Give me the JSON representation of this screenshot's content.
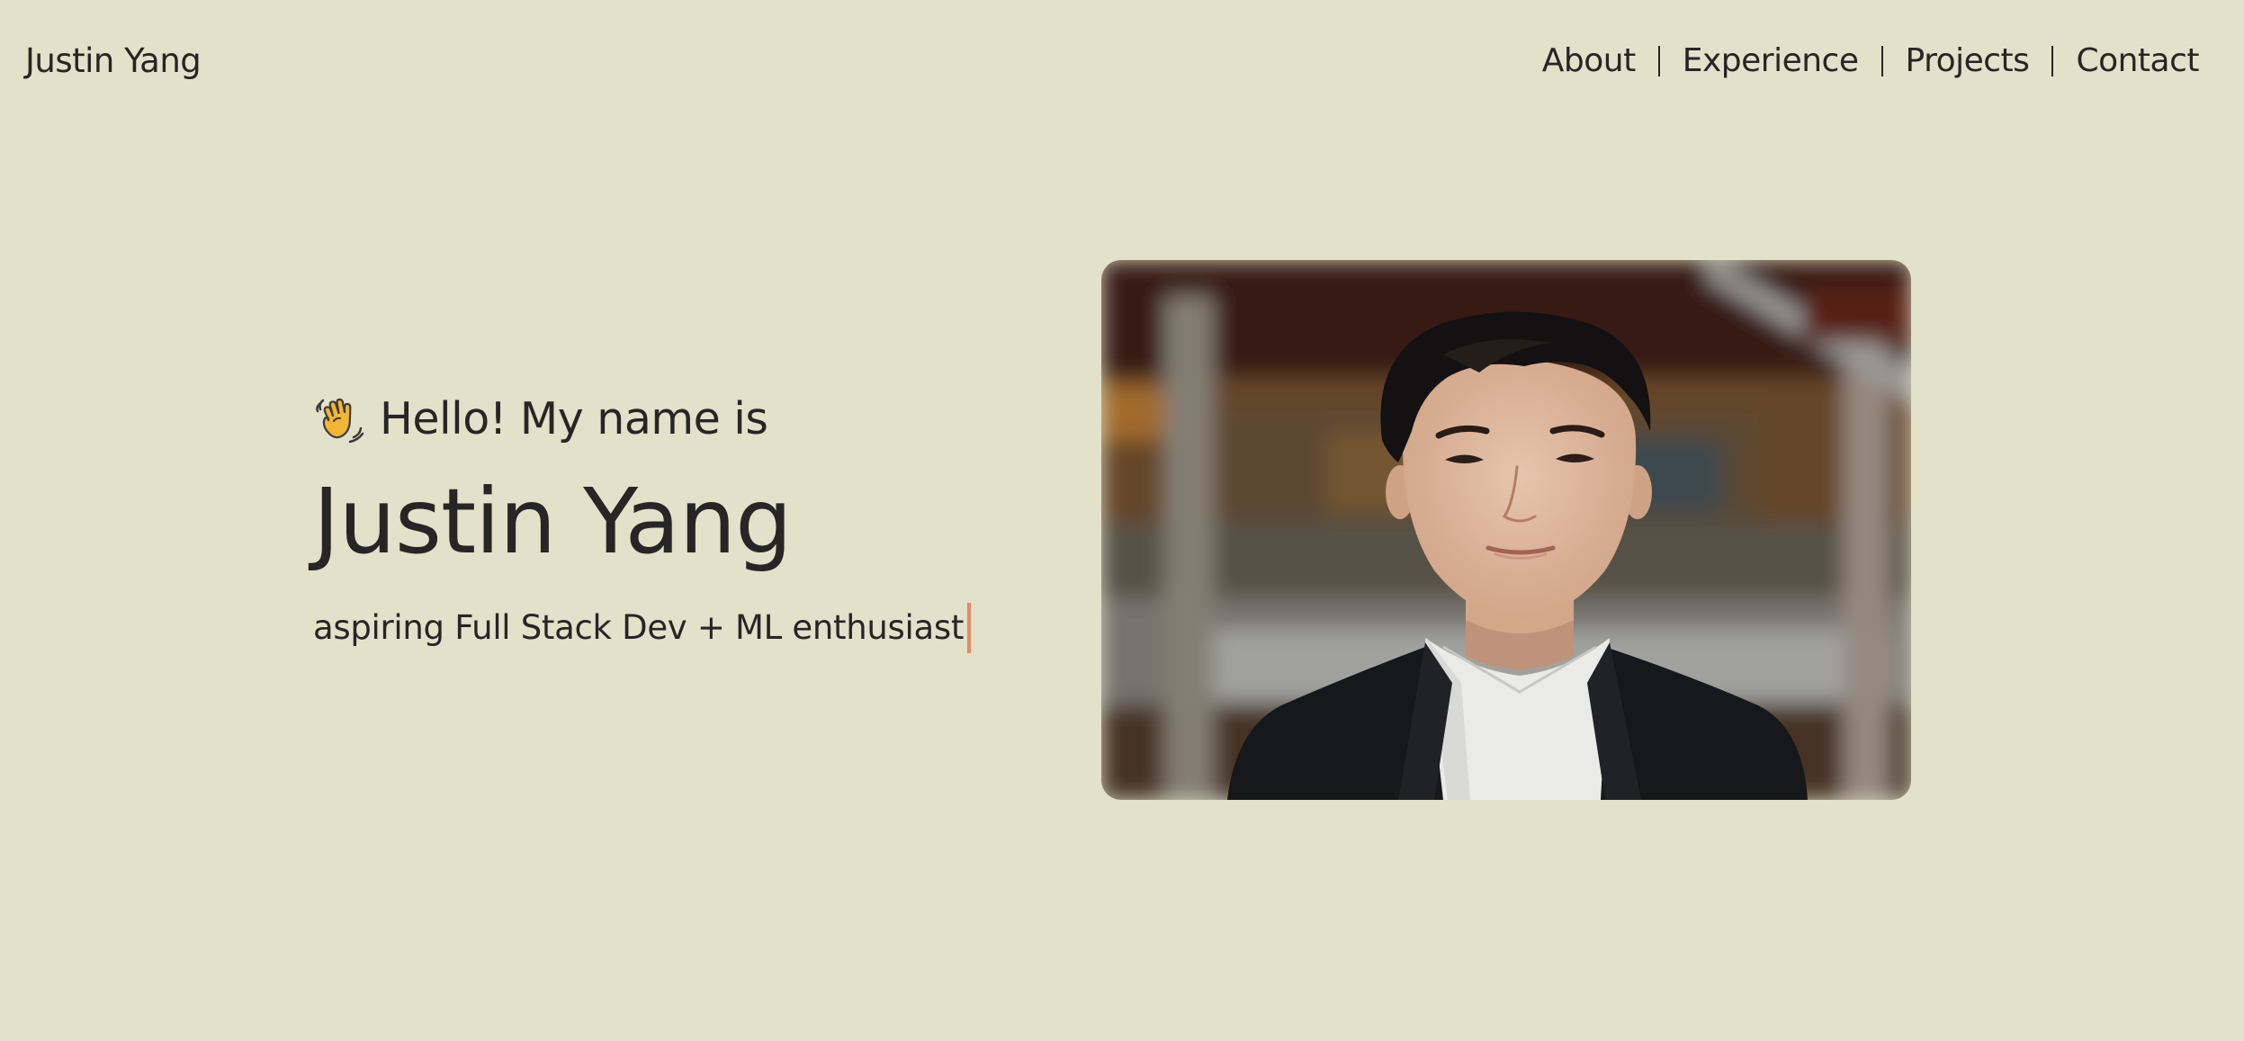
{
  "header": {
    "brand": "Justin Yang",
    "nav": [
      {
        "label": "About"
      },
      {
        "label": "Experience"
      },
      {
        "label": "Projects"
      },
      {
        "label": "Contact"
      }
    ]
  },
  "hero": {
    "greeting_icon": "waving-hand-icon",
    "greeting": "Hello! My name is",
    "name": "Justin Yang",
    "tagline": "aspiring Full Stack Dev + ML enthusiast"
  },
  "colors": {
    "background": "#e2e1c9",
    "text": "#262626",
    "cursor": "#e58a62"
  }
}
